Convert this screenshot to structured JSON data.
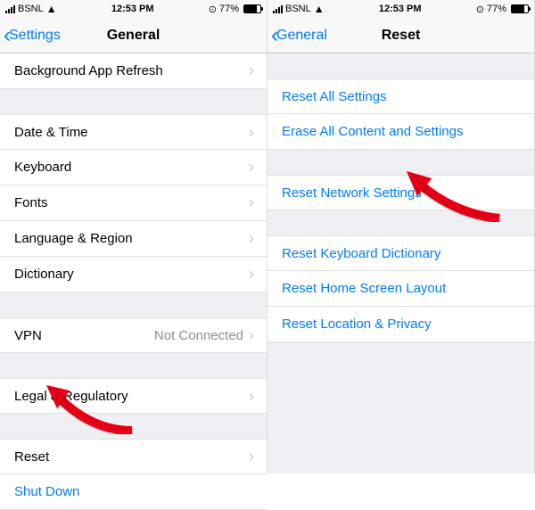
{
  "status": {
    "carrier": "BSNL",
    "time": "12:53 PM",
    "battery": "77%"
  },
  "left": {
    "back": "Settings",
    "title": "General",
    "rows": {
      "background_refresh": "Background App Refresh",
      "date_time": "Date & Time",
      "keyboard": "Keyboard",
      "fonts": "Fonts",
      "language_region": "Language & Region",
      "dictionary": "Dictionary",
      "vpn": "VPN",
      "vpn_status": "Not Connected",
      "legal": "Legal & Regulatory",
      "reset": "Reset",
      "shutdown": "Shut Down"
    }
  },
  "right": {
    "back": "General",
    "title": "Reset",
    "rows": {
      "reset_all": "Reset All Settings",
      "erase_all": "Erase All Content and Settings",
      "reset_network": "Reset Network Settings",
      "reset_keyboard": "Reset Keyboard Dictionary",
      "reset_home": "Reset Home Screen Layout",
      "reset_location": "Reset Location & Privacy"
    }
  }
}
